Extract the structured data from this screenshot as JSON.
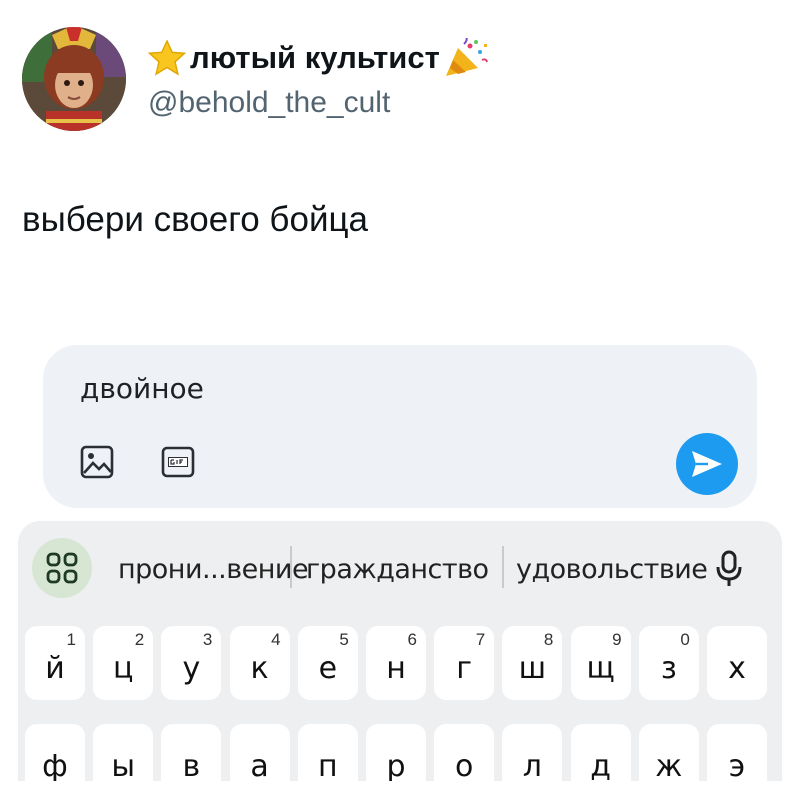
{
  "tweet": {
    "display_name": "лютый культист",
    "handle": "@behold_the_cult",
    "text": "выбери своего бойца"
  },
  "compose": {
    "input_text": "двойное"
  },
  "keyboard": {
    "suggestions": [
      "прони...вение",
      "гражданство",
      "удовольствие"
    ],
    "row1": [
      {
        "letter": "й",
        "digit": "1"
      },
      {
        "letter": "ц",
        "digit": "2"
      },
      {
        "letter": "у",
        "digit": "3"
      },
      {
        "letter": "к",
        "digit": "4"
      },
      {
        "letter": "е",
        "digit": "5"
      },
      {
        "letter": "н",
        "digit": "6"
      },
      {
        "letter": "г",
        "digit": "7"
      },
      {
        "letter": "ш",
        "digit": "8"
      },
      {
        "letter": "щ",
        "digit": "9"
      },
      {
        "letter": "з",
        "digit": "0"
      },
      {
        "letter": "х",
        "digit": ""
      }
    ],
    "row2": [
      "ф",
      "ы",
      "в",
      "а",
      "п",
      "р",
      "о",
      "л",
      "д",
      "ж",
      "э"
    ]
  },
  "colors": {
    "send_button": "#1d9bf0",
    "compose_bg": "#eef1f6",
    "keyboard_bg": "#edeff0",
    "handle_gray": "#536471"
  },
  "icons": [
    "star-emoji-icon",
    "party-popper-emoji-icon",
    "image-icon",
    "gif-icon",
    "send-icon",
    "keyboard-apps-icon",
    "microphone-icon"
  ]
}
